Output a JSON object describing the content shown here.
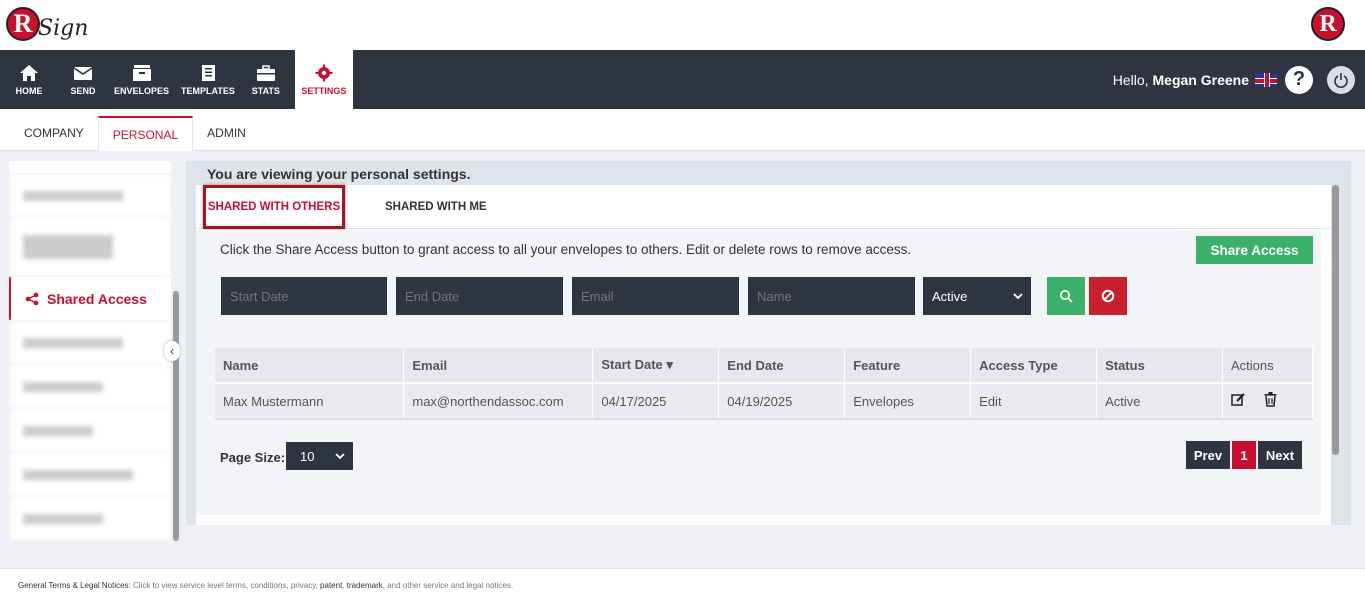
{
  "brand": {
    "logo_letter": "R",
    "logo_text": "Sign",
    "right_logo_letter": "R",
    "accent": "#c8102e",
    "nav_bg": "#2e3440"
  },
  "nav": {
    "items": [
      {
        "label": "HOME",
        "icon": "home-icon"
      },
      {
        "label": "SEND",
        "icon": "envelope-icon"
      },
      {
        "label": "ENVELOPES",
        "icon": "inbox-icon"
      },
      {
        "label": "TEMPLATES",
        "icon": "document-icon"
      },
      {
        "label": "STATS",
        "icon": "briefcase-icon"
      },
      {
        "label": "SETTINGS",
        "icon": "gear-icon",
        "active": true
      }
    ],
    "greeting": "Hello,",
    "user_name": "Megan Greene",
    "help_label": "?"
  },
  "subtabs": [
    {
      "label": "COMPANY"
    },
    {
      "label": "PERSONAL",
      "active": true
    },
    {
      "label": "ADMIN"
    }
  ],
  "sidebar": {
    "active_label": "Shared Access",
    "collapse_glyph": "‹"
  },
  "main": {
    "title": "You are viewing your personal settings.",
    "tabs": [
      {
        "label": "SHARED WITH OTHERS",
        "active": true
      },
      {
        "label": "SHARED WITH ME"
      }
    ],
    "info": "Click the Share Access button to grant access to all your envelopes to others. Edit or delete rows to remove access.",
    "share_button": "Share Access",
    "filters": {
      "start_date_placeholder": "Start Date",
      "end_date_placeholder": "End Date",
      "email_placeholder": "Email",
      "name_placeholder": "Name",
      "status_value": "Active"
    },
    "table": {
      "headers": [
        "Name",
        "Email",
        "Start Date",
        "End Date",
        "Feature",
        "Access Type",
        "Status",
        "Actions"
      ],
      "sort_glyph": "▾",
      "rows": [
        {
          "name": "Max Mustermann",
          "email": "max@northendassoc.com",
          "start": "04/17/2025",
          "end": "04/19/2025",
          "feature": "Envelopes",
          "access": "Edit",
          "status": "Active"
        }
      ]
    },
    "page_size_label": "Page Size:",
    "page_size_value": "10",
    "pager": {
      "prev": "Prev",
      "current": "1",
      "next": "Next"
    }
  },
  "footer": {
    "title": "General Terms & Legal Notices",
    "text1": ": Click to view service level terms, conditions, privacy, ",
    "patent": "patent",
    "comma": ", ",
    "trademark": "trademark",
    "text2": ", and other service and legal notices."
  }
}
